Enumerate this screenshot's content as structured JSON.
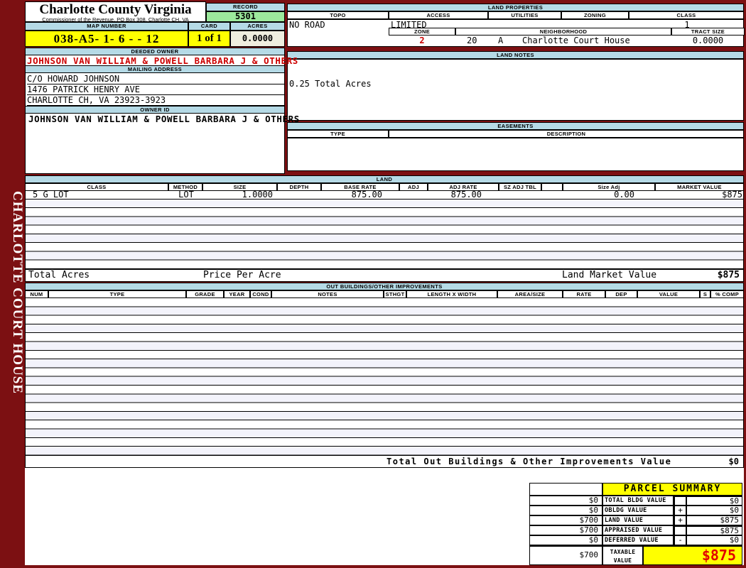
{
  "banner": {
    "vertical_text": "CHARLOTTE COURT HOUSE"
  },
  "header": {
    "county_title": "Charlotte County Virginia",
    "county_subtitle": "Commissioner of the Revenue, PO Box 308, Charlotte CH, VA",
    "record_label": "RECORD",
    "record_value": "5301",
    "map_number_label": "MAP NUMBER",
    "map_number_value": "038-A5- 1- 6 -   - 12",
    "card_label": "CARD",
    "card_value": "1 of 1",
    "acres_label": "ACRES",
    "acres_value": "0.0000"
  },
  "land_properties": {
    "title": "LAND PROPERTIES",
    "topo_label": "TOPO",
    "access_label": "ACCESS",
    "utilities_label": "UTILITIES",
    "zoning_label": "ZONING",
    "class_label": "CLASS",
    "topo_value": "NO ROAD",
    "access_value": "LIMITED",
    "utilities_value": "",
    "zoning_value": "",
    "class_value": "1",
    "zone_label": "ZONE",
    "neighborhood_label": "NEIGHBORHOOD",
    "tract_size_label": "TRACT SIZE",
    "zone_value": "2",
    "zone_code": "20",
    "zone_suffix": "A",
    "neighborhood_value": "Charlotte Court House",
    "tract_size_value": "0.0000"
  },
  "owner": {
    "deeded_owner_label": "DEEDED OWNER",
    "deeded_owner": "JOHNSON VAN WILLIAM & POWELL BARBARA J & OTHERS",
    "mailing_label": "MAILING ADDRESS",
    "address_line1": "C/O HOWARD JOHNSON",
    "address_line2": "1476 PATRICK HENRY AVE",
    "address_line3": "CHARLOTTE CH, VA 23923-3923",
    "owner_id_label": "OWNER ID",
    "owner_id": "JOHNSON VAN WILLIAM & POWELL BARBARA J & OTHERS"
  },
  "land_notes": {
    "title": "LAND NOTES",
    "note": "0.25 Total Acres"
  },
  "easements": {
    "title": "EASEMENTS",
    "type_label": "TYPE",
    "description_label": "DESCRIPTION"
  },
  "land_table": {
    "title": "LAND",
    "headers": [
      "CLASS",
      "METHOD",
      "SIZE",
      "DEPTH",
      "BASE RATE",
      "ADJ",
      "ADJ RATE",
      "SZ ADJ TBL",
      "Size Adj",
      "MARKET VALUE"
    ],
    "row": {
      "class": "5 G LOT",
      "method": "LOT",
      "size": "1.0000",
      "depth": "",
      "base_rate": "875.00",
      "adj": "",
      "adj_rate": "875.00",
      "sz_adj_tbl": "",
      "size_adj": "0.00",
      "market_value": "$875"
    },
    "footer": {
      "total_acres_label": "Total Acres",
      "price_per_acre_label": "Price Per Acre",
      "market_label": "Land Market Value",
      "market_value": "$875"
    }
  },
  "out_buildings": {
    "title": "OUT BUILDINGS/OTHER IMPROVEMENTS",
    "headers": [
      "NUM",
      "TYPE",
      "GRADE",
      "YEAR",
      "COND",
      "NOTES",
      "STHGT",
      "LENGTH X WIDTH",
      "AREA/SIZE",
      "RATE",
      "DEP",
      "VALUE",
      "S",
      "% COMP"
    ],
    "total_label": "Total Out Buildings & Other Improvements Value",
    "total_value": "$0"
  },
  "parcel_summary": {
    "title": "PARCEL SUMMARY",
    "rows": [
      {
        "prior": "$0",
        "label": "TOTAL BLDG VALUE",
        "op": "",
        "value": "$0"
      },
      {
        "prior": "$0",
        "label": "OBLDG VALUE",
        "op": "+",
        "value": "$0"
      },
      {
        "prior": "$700",
        "label": "LAND VALUE",
        "op": "+",
        "value": "$875"
      },
      {
        "prior": "$700",
        "label": "APPRAISED VALUE",
        "op": "",
        "value": "$875"
      },
      {
        "prior": "$0",
        "label": "DEFERRED VALUE",
        "op": "-",
        "value": "$0"
      }
    ],
    "taxable": {
      "prior": "$700",
      "label": "TAXABLE VALUE",
      "value": "$875"
    }
  },
  "colors": {
    "maroon_background": "#7C1012",
    "section_bar_blue": "#B5DAE6",
    "highlight_yellow": "#FFFF00",
    "record_green": "#9CE99C",
    "acres_beige": "#EFEEDF",
    "alert_red": "#CC0000",
    "stripe_lavender": "#F3F3FB"
  }
}
